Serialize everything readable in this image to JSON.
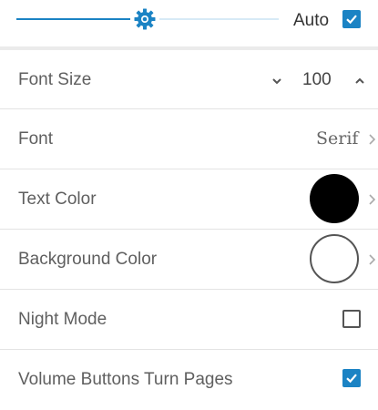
{
  "brightness": {
    "level": 0.49,
    "auto_label": "Auto",
    "auto_checked": true,
    "colors": {
      "accent": "#1b83c4",
      "track_empty": "#d7eaf6"
    }
  },
  "settings": {
    "font_size": {
      "label": "Font Size",
      "value": "100"
    },
    "font": {
      "label": "Font",
      "value": "Serif"
    },
    "text_color": {
      "label": "Text Color",
      "color": "#000000"
    },
    "background_color": {
      "label": "Background Color",
      "color": "#ffffff"
    },
    "night_mode": {
      "label": "Night Mode",
      "checked": false
    },
    "volume_buttons": {
      "label": "Volume Buttons Turn Pages",
      "checked": true
    }
  },
  "icons": {
    "brightness": "sun-gear-icon",
    "decrease": "chevron-down-icon",
    "increase": "chevron-up-icon",
    "navigate": "chevron-right-icon",
    "checked": "checkmark-icon"
  }
}
